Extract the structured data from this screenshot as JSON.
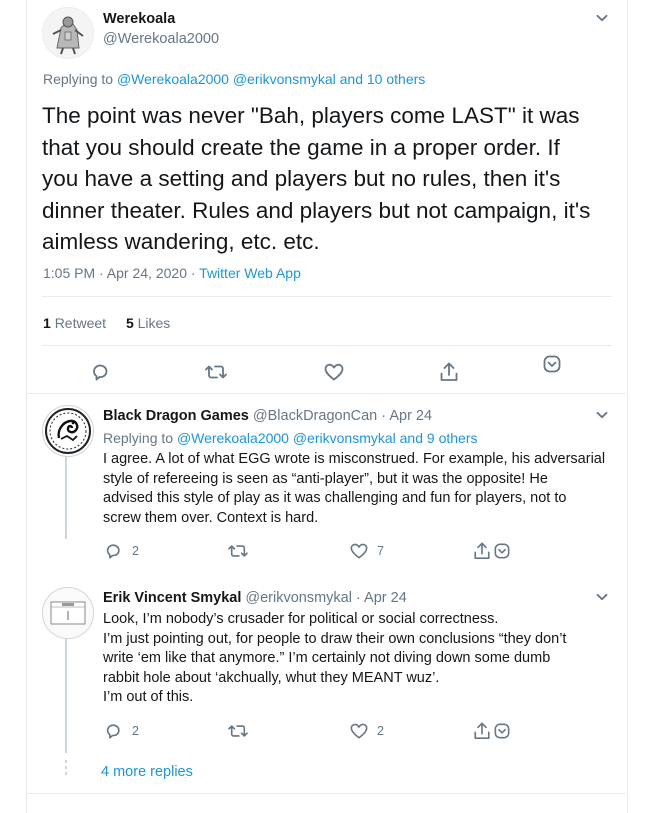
{
  "main_tweet": {
    "author_name": "Werekoala",
    "author_handle": "@Werekoala2000",
    "replying_prefix": "Replying to ",
    "replying_users": "@Werekoala2000 @erikvonsmykal",
    "replying_and": " and ",
    "replying_others": "10 others",
    "text_lines": [
      "The point was never \"Bah, players come LAST\" it was",
      "that you should create the game in a proper order. If",
      "you have a setting and players but no rules, then it's",
      "dinner theater. Rules and players but not campaign, it's",
      "aimless wandering, etc. etc."
    ],
    "timestamp": "1:05 PM · Apr 24, 2020 · ",
    "source": "Twitter Web App",
    "retweet_count": "1",
    "retweet_label": "Retweet",
    "like_count": "5",
    "like_label": "Likes"
  },
  "replies": [
    {
      "author_name": "Black Dragon Games",
      "author_handle": "@BlackDragonCan",
      "date": "· Apr 24",
      "replying_prefix": "Replying to ",
      "replying_users": "@Werekoala2000 @erikvonsmykal",
      "replying_and": " and ",
      "replying_others": "9 others",
      "text_lines": [
        "I agree. A lot of what EGG wrote is misconstrued. For example, his adversarial",
        "style of refereeing is seen as “anti-player”, but it was the opposite! He",
        "advised this style of play as it was challenging and fun for players, not to",
        "screw them over. Context is hard."
      ],
      "reply_count": "2",
      "retweet_count": "",
      "like_count": "7"
    },
    {
      "author_name": "Erik Vincent Smykal",
      "author_handle": "@erikvonsmykal",
      "date": "· Apr 24",
      "text_lines": [
        "Look, I’m nobody’s crusader for political or social correctness.",
        "I’m just pointing out, for people to draw their own conclusions “they don’t",
        "write ‘em like that anymore.” I’m certainly not diving down some dumb",
        "rabbit hole about ‘akchually, whut they MEANT wuz’.",
        "I’m out of this."
      ],
      "reply_count": "2",
      "retweet_count": "",
      "like_count": "2"
    }
  ],
  "more_replies": "4 more replies",
  "colors": {
    "link": "#1b95e0",
    "secondary_text": "#657786",
    "border": "#e6ecf0"
  }
}
